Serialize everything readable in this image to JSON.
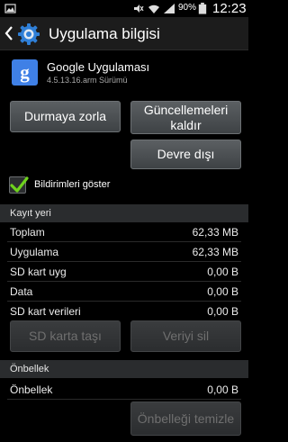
{
  "status_bar": {
    "battery_percent": "90%",
    "clock": "12:23",
    "icons": [
      "gallery-icon",
      "silent-icon",
      "wifi-icon",
      "signal-icon",
      "battery-icon"
    ]
  },
  "action_bar": {
    "title": "Uygulama bilgisi",
    "back_icon": "chevron-left-icon",
    "settings_icon": "gear-icon"
  },
  "app": {
    "icon_letter": "g",
    "name": "Google Uygulaması",
    "version": "4.5.13.16.arm Sürümü"
  },
  "buttons": {
    "force_stop": "Durmaya zorla",
    "uninstall_updates": "Güncellemeleri kaldır",
    "disable": "Devre dışı",
    "move_to_sd": "SD karta taşı",
    "clear_data": "Veriyi sil",
    "clear_cache": "Önbelleği temizle"
  },
  "notifications": {
    "label": "Bildirimleri göster",
    "checked": true
  },
  "storage": {
    "header": "Kayıt yeri",
    "rows": [
      {
        "label": "Toplam",
        "value": "62,33 MB"
      },
      {
        "label": "Uygulama",
        "value": "62,33 MB"
      },
      {
        "label": "SD kart uyg",
        "value": "0,00 B"
      },
      {
        "label": "Data",
        "value": "0,00 B"
      },
      {
        "label": "SD kart verileri",
        "value": "0,00 B"
      }
    ]
  },
  "cache": {
    "header": "Önbellek",
    "rows": [
      {
        "label": "Önbellek",
        "value": "0,00 B"
      }
    ]
  },
  "colors": {
    "accent_blue": "#3f80e6",
    "checkmark_green": "#6fd21d"
  }
}
